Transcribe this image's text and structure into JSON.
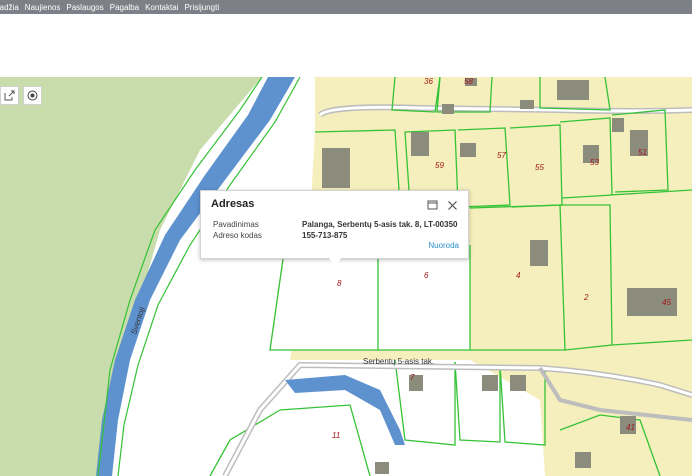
{
  "nav": [
    "radžia",
    "Naujienos",
    "Paslaugos",
    "Pagalba",
    "Kontaktai",
    "Prisijungti"
  ],
  "map": {
    "colors": {
      "plot_fill": "#f5efbe",
      "plot_border": "#35c235",
      "forest": "#c9dcab",
      "river": "#5d92cf",
      "road": "#bdbdbd",
      "building": "#8c8c7c"
    },
    "plot_numbers": [
      "36",
      "58",
      "59",
      "57",
      "55",
      "53",
      "51",
      "8",
      "6",
      "4",
      "2",
      "45",
      "7",
      "11",
      "41"
    ],
    "street_names": {
      "serbentu": "Serbentų 5-asis tak.",
      "river": "Sventoji"
    }
  },
  "controls": {
    "export_icon": "export-icon",
    "locate_icon": "locate-icon"
  },
  "popup": {
    "title": "Adresas",
    "labels": {
      "name": "Pavadinimas",
      "code": "Adreso kodas"
    },
    "values": {
      "name": "Palanga, Serbentų 5-asis tak. 8, LT-00350",
      "code": "155-713-875"
    },
    "link": "Nuoroda",
    "icons": {
      "maximize": "maximize-icon",
      "close": "close-icon"
    }
  }
}
